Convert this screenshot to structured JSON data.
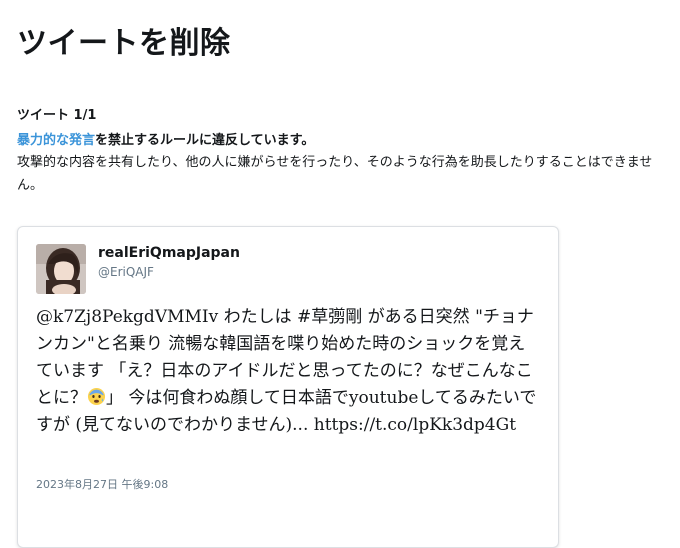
{
  "page": {
    "title": "ツイートを削除"
  },
  "notice": {
    "count": "ツイート 1/1",
    "policy_link": "暴力的な発言",
    "violation_suffix": "を禁止するルールに違反しています。",
    "description": "攻撃的な内容を共有したり、他の人に嫌がらせを行ったり、そのような行為を助長したりすることはできません。"
  },
  "tweet": {
    "display_name": "realEriQmapJapan",
    "handle": "@EriQAJF",
    "text_part1": "@k7Zj8PekgdVMMIv わたしは #草彅剛 がある日突然 \"チョナンカン\"と名乗り 流暢な韓国語を喋り始めた時のショックを覚えています 「え？日本のアイドルだと思ってたのに？なぜこんなことに？",
    "emoji": "fearful-face-emoji",
    "text_part2": "」 今は何食わぬ顔して日本語でyoutubeしてるみたいですが (見てないのでわかりません)... https://t.co/lpKk3dp4Gt",
    "timestamp": "2023年8月27日 午後9:08"
  },
  "colors": {
    "link": "#3b94d9",
    "secondary_text": "#657786",
    "card_border": "#dcdfe3"
  }
}
